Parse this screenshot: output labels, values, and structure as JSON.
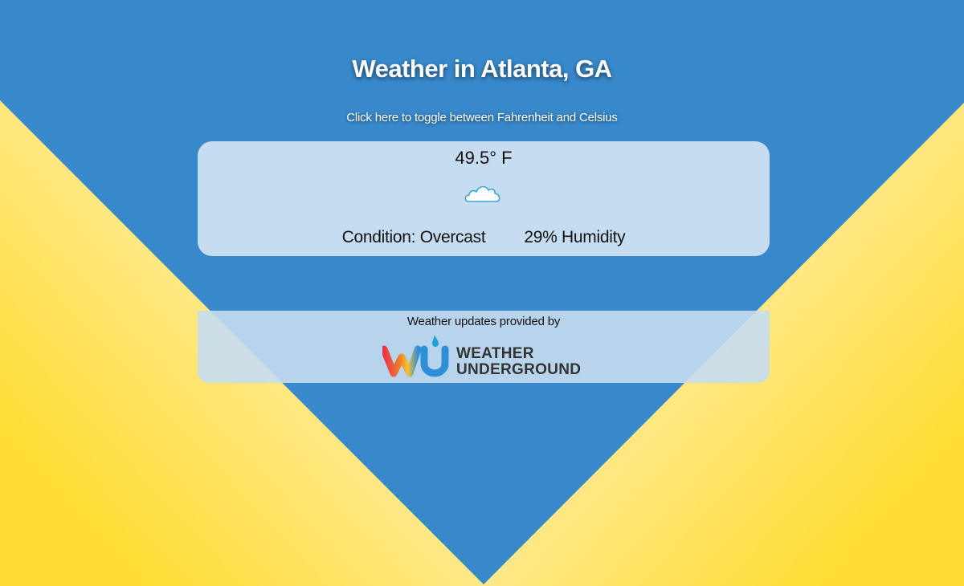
{
  "title": "Weather in Atlanta, GA",
  "toggle_text": "Click here to toggle between Fahrenheit and Celsius",
  "weather": {
    "temperature": "49.5° F",
    "condition_icon": "cloud-icon",
    "condition": "Condition: Overcast",
    "humidity": "29% Humidity"
  },
  "provider": {
    "label": "Weather updates provided by",
    "logo_text_line1": "WEATHER",
    "logo_text_line2": "UNDERGROUND"
  },
  "colors": {
    "background_blue": "#3889cc",
    "card": "#c6ddf1",
    "yellow": "#ffdd33",
    "text": "#111111"
  }
}
